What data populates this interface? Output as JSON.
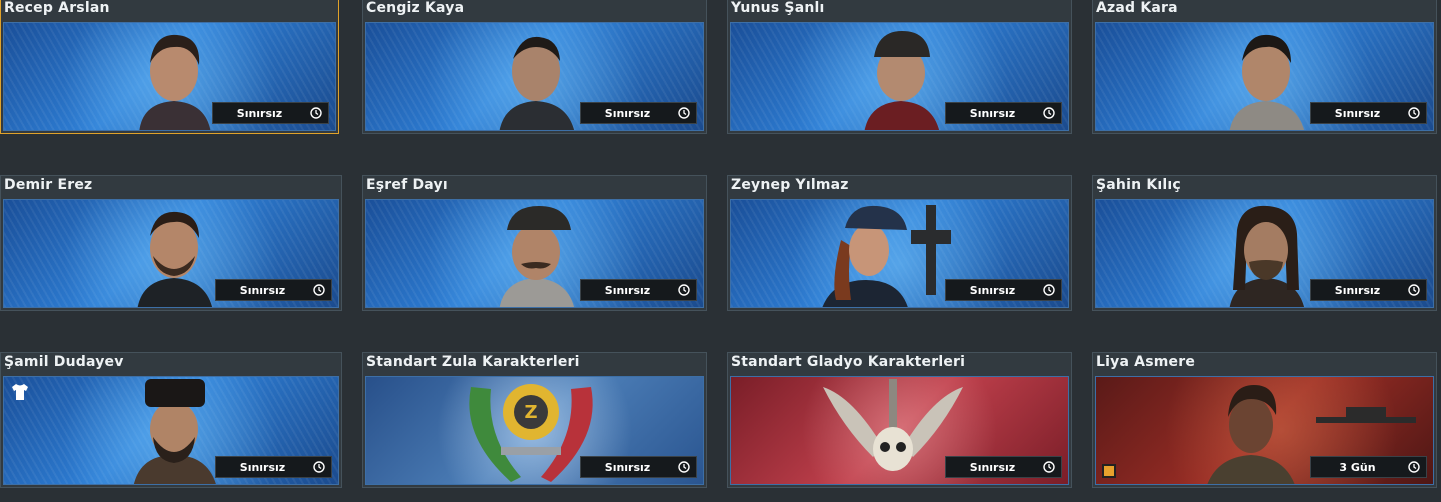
{
  "colors": {
    "selected_border": "#e0a22a",
    "card_bg": "#323a40",
    "badge_bg": "#15191c"
  },
  "cards": [
    {
      "name": "Recep Arslan",
      "duration": "Sınırsız",
      "theme": "blue",
      "selected": true
    },
    {
      "name": "Cengiz Kaya",
      "duration": "Sınırsız",
      "theme": "blue"
    },
    {
      "name": "Yunus Şanlı",
      "duration": "Sınırsız",
      "theme": "blue"
    },
    {
      "name": "Azad Kara",
      "duration": "Sınırsız",
      "theme": "blue"
    },
    {
      "name": "Demir Erez",
      "duration": "Sınırsız",
      "theme": "blue"
    },
    {
      "name": "Eşref Dayı",
      "duration": "Sınırsız",
      "theme": "blue"
    },
    {
      "name": "Zeynep Yılmaz",
      "duration": "Sınırsız",
      "theme": "blue"
    },
    {
      "name": "Şahin Kılıç",
      "duration": "Sınırsız",
      "theme": "blue"
    },
    {
      "name": "Şamil Dudayev",
      "duration": "Sınırsız",
      "theme": "blue",
      "icon": "shirt-icon"
    },
    {
      "name": "Standart Zula Karakterleri",
      "duration": "Sınırsız",
      "theme": "zula",
      "icon": "zula-emblem-icon"
    },
    {
      "name": "Standart Gladyo Karakterleri",
      "duration": "Sınırsız",
      "theme": "gladyo",
      "icon": "gladyo-skull-emblem-icon"
    },
    {
      "name": "Liya Asmere",
      "duration": "3 Gün",
      "theme": "liya",
      "icon": "flag-icon"
    }
  ]
}
